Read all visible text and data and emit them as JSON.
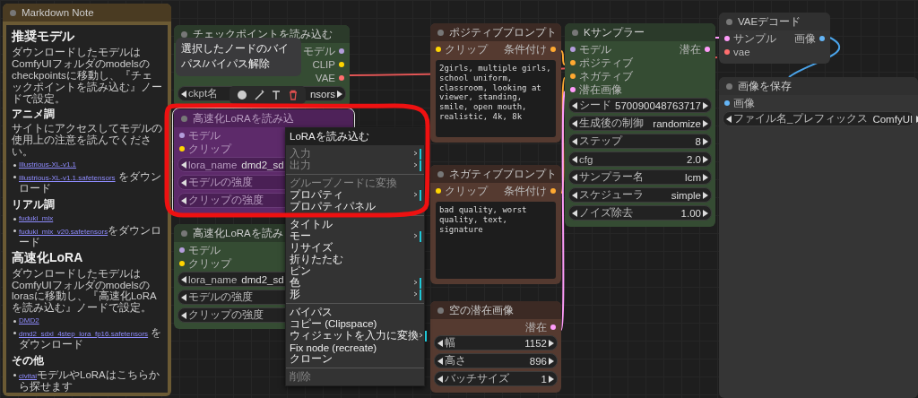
{
  "nodes": [
    {
      "title": "Markdown Note",
      "kind": "note",
      "selected": false,
      "bypassed": false,
      "blocks": [
        {
          "kind": "h1",
          "text": "推奨モデル"
        },
        {
          "kind": "p",
          "text": "ダウンロードしたモデルはComfyUIフォルダのmodelsのcheckpointsに移動し、『チェックポイントを読み込む』ノードで設定。"
        },
        {
          "kind": "h2",
          "text": "アニメ調"
        },
        {
          "kind": "p",
          "text": "サイトにアクセスしてモデルの使用上の注意を読んでください。"
        },
        {
          "kind": "list",
          "items": [
            {
              "link": "Illustrious-XL-v1.1"
            },
            {
              "link": "Illustrious-XL-v1.1.safetensors",
              "text": " をダウンロード"
            }
          ]
        },
        {
          "kind": "h2",
          "text": "リアル調"
        },
        {
          "kind": "list",
          "items": [
            {
              "link": "fuduki_mix"
            },
            {
              "link": "fuduki_mix_v20.safetensors",
              "text": "をダウンロード"
            }
          ]
        },
        {
          "kind": "h1",
          "text": "高速化LoRA"
        },
        {
          "kind": "p",
          "text": "ダウンロードしたモデルはComfyUIフォルダのmodelsのlorasに移動し、『高速化LoRAを読み込む』ノードで設定。"
        },
        {
          "kind": "list",
          "items": [
            {
              "link": "DMD2"
            },
            {
              "link": "dmd2_sdxl_4step_lora_fp16.safetensors",
              "text": " をダウンロード"
            }
          ]
        },
        {
          "kind": "h2",
          "text": "その他"
        },
        {
          "kind": "list",
          "items": [
            {
              "link": "civitai",
              "text": "モデルやLoRAはこちらから探せます"
            }
          ]
        }
      ]
    },
    {
      "title": "チェックポイントを読み込む",
      "kind": "green",
      "selected": false,
      "bypassed": false,
      "outputs": [
        {
          "label": "モデル",
          "color": "#b39ddb"
        },
        {
          "label": "CLIP",
          "color": "#ffd500"
        },
        {
          "label": "VAE",
          "color": "#ff6e6e"
        }
      ],
      "widgets": [
        {
          "label": "ckpt名",
          "value": "nsors"
        }
      ]
    },
    {
      "title": "高速化LoRAを読み込",
      "kind": "green",
      "selected": true,
      "bypassed": true,
      "inputs": [
        {
          "label": "モデル",
          "color": "#b39ddb"
        },
        {
          "label": "クリップ",
          "color": "#ffd500"
        }
      ],
      "widgets": [
        {
          "label": "lora_name",
          "value": "dmd2_sd"
        },
        {
          "label": "モデルの強度"
        },
        {
          "label": "クリップの強度"
        }
      ]
    },
    {
      "title": "高速化LoRAを読み",
      "kind": "green",
      "selected": false,
      "bypassed": false,
      "inputs": [
        {
          "label": "モデル",
          "color": "#b39ddb"
        },
        {
          "label": "クリップ",
          "color": "#ffd500"
        }
      ],
      "widgets": [
        {
          "label": "lora_name",
          "value": "dmd2_sd"
        },
        {
          "label": "モデルの強度"
        },
        {
          "label": "クリップの強度"
        }
      ]
    },
    {
      "title": "ポジティブプロンプト",
      "kind": "brown",
      "selected": false,
      "bypassed": false,
      "inputs": [
        {
          "label": "クリップ",
          "color": "#ffd500"
        }
      ],
      "outputs": [
        {
          "label": "条件付け",
          "color": "#ffa931"
        }
      ],
      "text": "2girls, multiple girls, school uniform, classroom, looking at viewer, standing, smile, open mouth, realistic, 4k, 8k"
    },
    {
      "title": "ネガティブプロンプト",
      "kind": "brown",
      "selected": false,
      "bypassed": false,
      "inputs": [
        {
          "label": "クリップ",
          "color": "#ffd500"
        }
      ],
      "outputs": [
        {
          "label": "条件付け",
          "color": "#ffa931"
        }
      ],
      "text": "bad quality, worst quality, text, signature"
    },
    {
      "title": "空の潜在画像",
      "kind": "brown",
      "selected": false,
      "bypassed": false,
      "outputs": [
        {
          "label": "潜在",
          "color": "#ff9cf9"
        }
      ],
      "widgets": [
        {
          "label": "幅",
          "value": "1152"
        },
        {
          "label": "高さ",
          "value": "896"
        },
        {
          "label": "バッチサイズ",
          "value": "1"
        }
      ]
    },
    {
      "title": "Kサンプラー",
      "kind": "green",
      "selected": false,
      "bypassed": false,
      "inputs": [
        {
          "label": "モデル",
          "color": "#b39ddb"
        },
        {
          "label": "ポジティブ",
          "color": "#ffa931"
        },
        {
          "label": "ネガティブ",
          "color": "#ffa931"
        },
        {
          "label": "潜在画像",
          "color": "#ff9cf9"
        }
      ],
      "outputs": [
        {
          "label": "潜在",
          "color": "#ff9cf9"
        }
      ],
      "widgets": [
        {
          "label": "シード",
          "value": "570090048763717"
        },
        {
          "label": "生成後の制御",
          "value": "randomize"
        },
        {
          "label": "ステップ",
          "value": "8"
        },
        {
          "label": "cfg",
          "value": "2.0"
        },
        {
          "label": "サンプラー名",
          "value": "lcm"
        },
        {
          "label": "スケジューラ",
          "value": "simple"
        },
        {
          "label": "ノイズ除去",
          "value": "1.00"
        }
      ]
    },
    {
      "title": "VAEデコード",
      "kind": "gray",
      "selected": false,
      "bypassed": false,
      "inputs": [
        {
          "label": "サンプル",
          "color": "#ff9cf9"
        },
        {
          "label": "vae",
          "color": "#ff6e6e"
        }
      ],
      "outputs": [
        {
          "label": "画像",
          "color": "#64b5f6"
        }
      ]
    },
    {
      "title": "画像を保存",
      "kind": "gray",
      "selected": false,
      "bypassed": false,
      "inputs": [
        {
          "label": "画像",
          "color": "#64b5f6"
        }
      ],
      "widgets": [
        {
          "label": "ファイル名_プレフィックス",
          "value": "ComfyUI"
        }
      ]
    }
  ],
  "tooltip": "選択したノードのバイパス/バイパス解除",
  "context_menu": {
    "title": "LoRAを読み込む",
    "groups": [
      [
        {
          "label": "入力",
          "disabled": true,
          "submenu": true
        },
        {
          "label": "出力",
          "disabled": true,
          "submenu": true
        }
      ],
      [
        {
          "label": "グループノードに変換",
          "disabled": true,
          "submenu": false
        },
        {
          "label": "プロパティ",
          "disabled": false,
          "submenu": true
        },
        {
          "label": "プロパティパネル",
          "disabled": false,
          "submenu": false
        }
      ],
      [
        {
          "label": "タイトル",
          "disabled": false,
          "submenu": false
        },
        {
          "label": "モー",
          "disabled": false,
          "submenu": true
        },
        {
          "label": "リサイズ",
          "disabled": false,
          "submenu": false
        },
        {
          "label": "折りたたむ",
          "disabled": false,
          "submenu": false
        },
        {
          "label": "ピン",
          "disabled": false,
          "submenu": false
        },
        {
          "label": "色",
          "disabled": false,
          "submenu": true
        },
        {
          "label": "形",
          "disabled": false,
          "submenu": true
        }
      ],
      [
        {
          "label": "バイパス",
          "disabled": false,
          "submenu": false
        },
        {
          "label": "コピー (Clipspace)",
          "disabled": false,
          "submenu": false
        },
        {
          "label": "ウィジェットを入力に変換",
          "disabled": false,
          "submenu": true
        },
        {
          "label": "Fix node (recreate)",
          "disabled": false,
          "submenu": false
        },
        {
          "label": "クローン",
          "disabled": false,
          "submenu": false
        }
      ],
      [
        {
          "label": "削除",
          "disabled": true,
          "submenu": false
        }
      ]
    ]
  }
}
